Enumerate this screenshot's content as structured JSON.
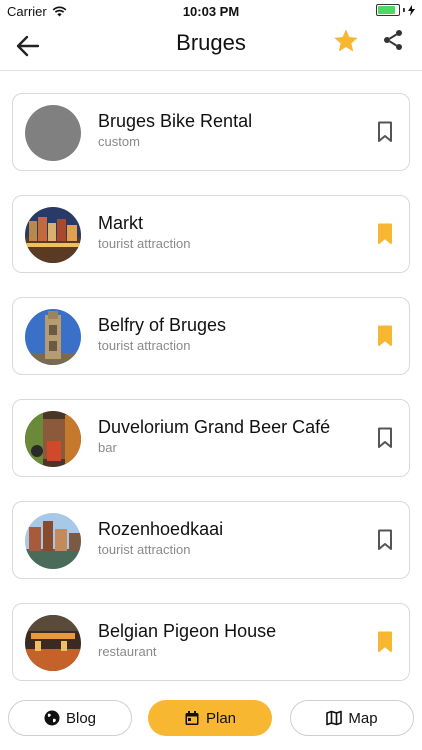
{
  "status_bar": {
    "carrier": "Carrier",
    "time": "10:03 PM",
    "battery_level": 0.85
  },
  "header": {
    "title": "Bruges",
    "accent_color": "#f7b731",
    "icons": [
      "back-arrow-icon",
      "star-icon",
      "share-icon"
    ]
  },
  "places": [
    {
      "name": "Bruges Bike Rental",
      "type": "custom",
      "bookmarked": false,
      "thumb": "gray-placeholder"
    },
    {
      "name": "Markt",
      "type": "tourist attraction",
      "bookmarked": true,
      "thumb": "market-square-photo"
    },
    {
      "name": "Belfry of Bruges",
      "type": "tourist attraction",
      "bookmarked": true,
      "thumb": "belfry-tower-photo"
    },
    {
      "name": "Duvelorium Grand Beer Café",
      "type": "bar",
      "bookmarked": false,
      "thumb": "beer-cafe-photo"
    },
    {
      "name": "Rozenhoedkaai",
      "type": "tourist attraction",
      "bookmarked": false,
      "thumb": "canal-photo"
    },
    {
      "name": "Belgian Pigeon House",
      "type": "restaurant",
      "bookmarked": true,
      "thumb": "restaurant-photo"
    }
  ],
  "tabs": [
    {
      "label": "Blog",
      "icon": "globe-icon",
      "active": false
    },
    {
      "label": "Plan",
      "icon": "calendar-icon",
      "active": true
    },
    {
      "label": "Map",
      "icon": "map-icon",
      "active": false
    }
  ]
}
